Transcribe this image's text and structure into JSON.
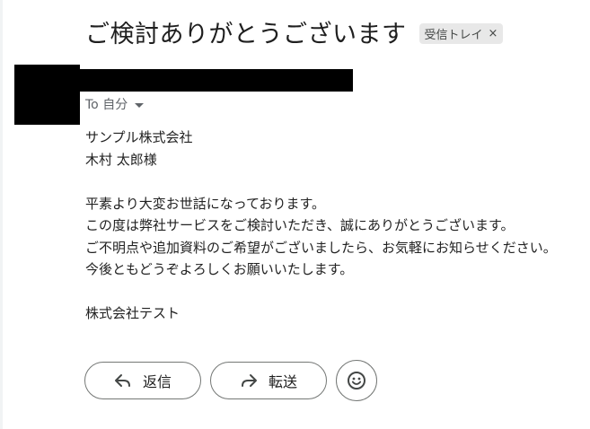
{
  "email": {
    "subject": "ご検討ありがとうございます",
    "label": "受信トレイ",
    "label_close": "×",
    "to_line": "To 自分",
    "body_lines": [
      "サンプル株式会社",
      "木村 太郎様",
      "",
      "平素より大変お世話になっております。",
      "この度は弊社サービスをご検討いただき、誠にありがとうございます。",
      "ご不明点や追加資料のご希望がございましたら、お気軽にお知らせください。",
      "今後ともどうぞよろしくお願いいたします。",
      "",
      "株式会社テスト"
    ]
  },
  "actions": {
    "reply_label": "返信",
    "forward_label": "転送"
  },
  "icons": {
    "reply": "reply-icon",
    "forward": "forward-icon",
    "emoji": "emoji-icon",
    "caret": "chevron-down-icon"
  }
}
